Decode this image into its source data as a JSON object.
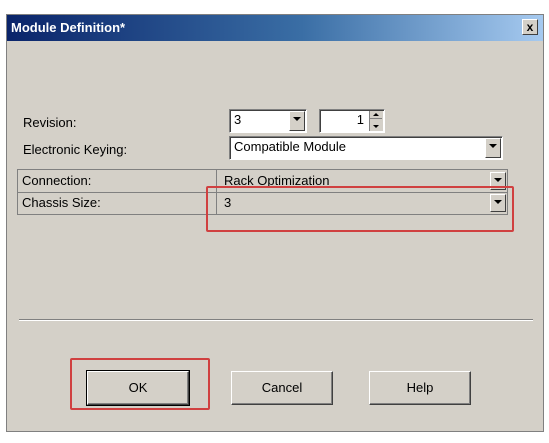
{
  "dialog": {
    "title": "Module Definition*",
    "close_label": "x"
  },
  "form": {
    "revision_label": "Revision:",
    "revision_major": "3",
    "revision_minor": "1",
    "keying_label": "Electronic Keying:",
    "keying_value": "Compatible Module"
  },
  "grid": {
    "rows": [
      {
        "label": "Connection:",
        "value": "Rack Optimization"
      },
      {
        "label": "Chassis Size:",
        "value": "3"
      }
    ]
  },
  "buttons": {
    "ok": "OK",
    "cancel": "Cancel",
    "help": "Help"
  },
  "colors": {
    "highlight": "#d04040",
    "titlebar": "#0a246a",
    "dialog_bg": "#d4d0c8"
  }
}
